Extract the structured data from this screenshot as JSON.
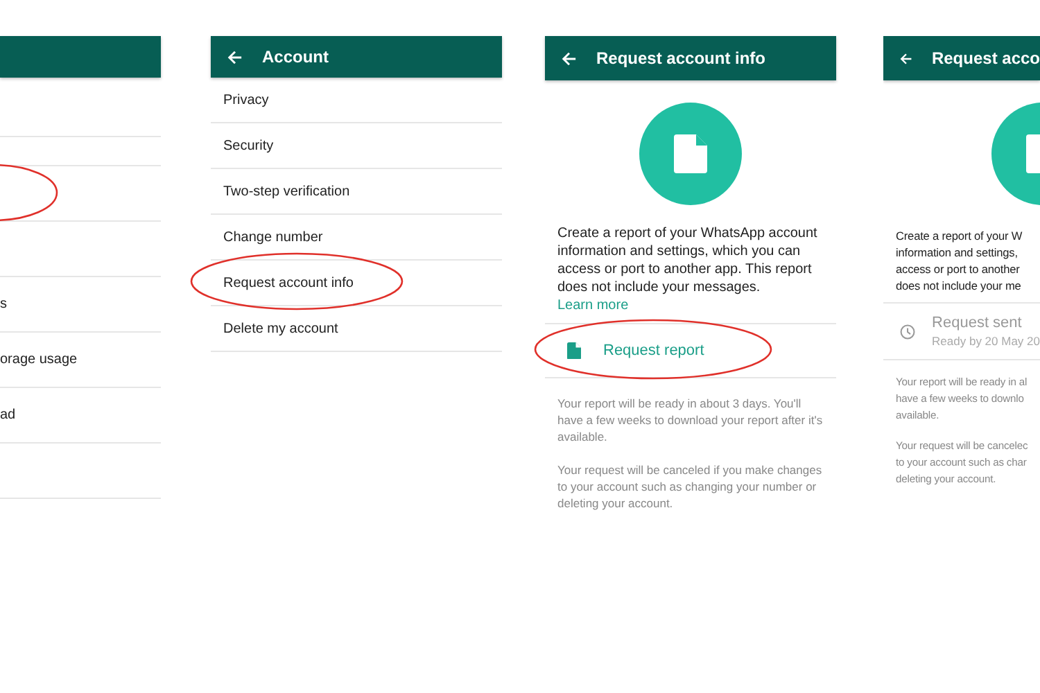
{
  "panels": [
    {
      "kind": "list",
      "back": false,
      "rows": [
        {
          "kind": "blank",
          "circled": false
        },
        {
          "kind": "blank",
          "circled": false,
          "short": true
        },
        {
          "kind": "blank",
          "circled": true
        },
        {
          "kind": "blank",
          "circled": false
        },
        {
          "kind": "text",
          "label": "s",
          "circled": false
        },
        {
          "kind": "text",
          "label": "orage usage",
          "circled": false
        },
        {
          "kind": "text",
          "label": "ad",
          "circled": false
        },
        {
          "kind": "blank",
          "circled": false
        }
      ]
    },
    {
      "kind": "list",
      "title": "Account",
      "back": true,
      "rows": [
        {
          "kind": "text",
          "label": "Privacy",
          "circled": false
        },
        {
          "kind": "text",
          "label": "Security",
          "circled": false
        },
        {
          "kind": "text",
          "label": "Two-step verification",
          "circled": false
        },
        {
          "kind": "text",
          "label": "Change number",
          "circled": false
        },
        {
          "kind": "text",
          "label": "Request account info",
          "circled": true
        },
        {
          "kind": "text",
          "label": "Delete my account",
          "circled": false
        }
      ]
    },
    {
      "kind": "report",
      "title": "Request account info",
      "back": true,
      "description": "Create a report of your WhatsApp account information and settings, which you can access or port to another app. This report does not include your messages.",
      "link": "Learn more",
      "action": {
        "kind": "request",
        "label": "Request report",
        "circled": true
      },
      "notes": [
        "Your report will be ready in about 3 days. You'll have a few weeks to download your report after it's available.",
        "Your request will be canceled if you make changes to your account such as changing your number or deleting your account."
      ]
    },
    {
      "kind": "cut",
      "title": "Request acco",
      "back": true,
      "description_lines": [
        "Create a report of your W",
        "information and settings,",
        "access or port to another",
        "does not include your me"
      ],
      "status": {
        "title": "Request sent",
        "subtitle": "Ready by 20 May 20"
      },
      "notes": [
        [
          "Your report will be ready in al",
          "have a few weeks to downlo",
          "available."
        ],
        [
          "Your request will be cancelec",
          "to your account such as char",
          "deleting your account."
        ]
      ]
    }
  ]
}
